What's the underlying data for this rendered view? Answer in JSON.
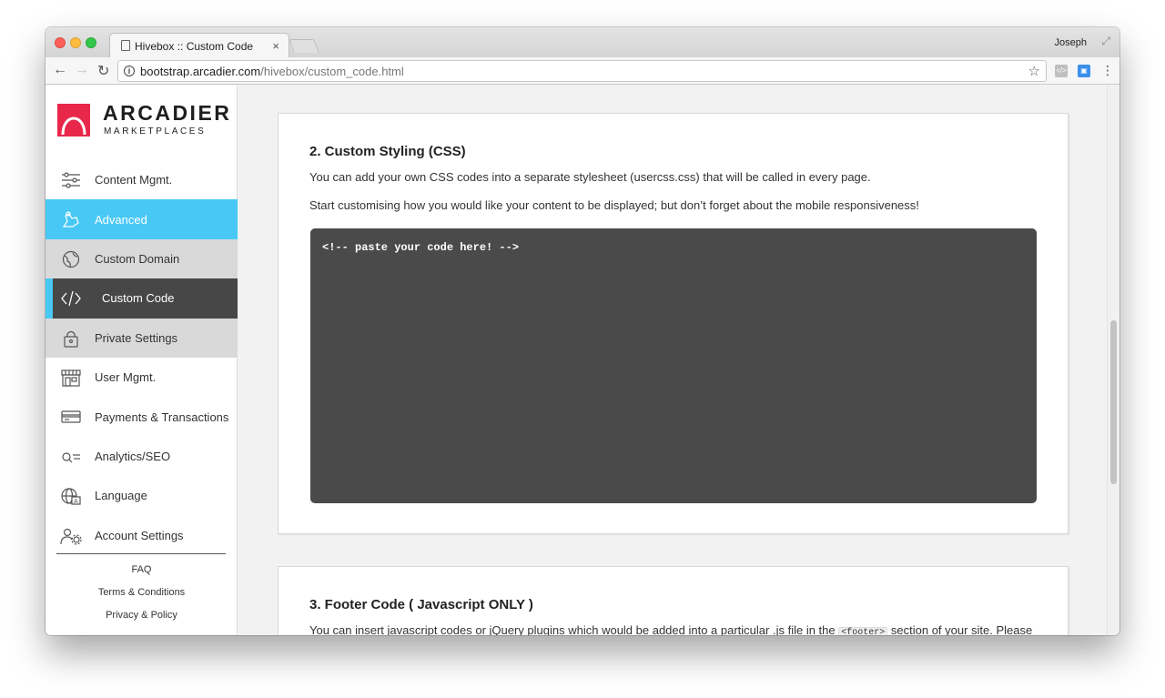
{
  "browser": {
    "tab_title": "Hivebox :: Custom Code",
    "tab_close": "×",
    "profile_name": "Joseph",
    "url_host": "bootstrap.arcadier.com",
    "url_path": "/hivebox/custom_code.html"
  },
  "brand": {
    "name": "ARCADIER",
    "tagline": "MARKETPLACES",
    "color": "#e8274b"
  },
  "sidebar": {
    "items": [
      {
        "label": "Content Mgmt.",
        "icon": "sliders-icon"
      },
      {
        "label": "Advanced",
        "icon": "hand-settings-icon"
      },
      {
        "label": "Custom Domain",
        "icon": "globe-icon"
      },
      {
        "label": "Custom Code",
        "icon": "code-icon"
      },
      {
        "label": "Private Settings",
        "icon": "lock-icon"
      },
      {
        "label": "User Mgmt.",
        "icon": "storefront-icon"
      },
      {
        "label": "Payments & Transactions",
        "icon": "card-icon"
      },
      {
        "label": "Analytics/SEO",
        "icon": "search-list-icon"
      },
      {
        "label": "Language",
        "icon": "language-globe-icon"
      },
      {
        "label": "Account Settings",
        "icon": "users-gear-icon"
      }
    ],
    "footer": [
      "FAQ",
      "Terms & Conditions",
      "Privacy & Policy"
    ]
  },
  "section_css": {
    "title": "2. Custom Styling (CSS)",
    "desc1": "You can add your own CSS codes into a separate stylesheet (usercss.css) that will be called in every page.",
    "desc2": "Start customising how you would like your content to be displayed; but don’t forget about the mobile responsiveness!",
    "code_placeholder": "<!-- paste your code here! -->"
  },
  "section_footer": {
    "title": "3. Footer Code ( Javascript ONLY )",
    "desc_a": "You can insert javascript codes or jQuery plugins which would be added into a particular .js file in the",
    "desc_code": "<footer>",
    "desc_b": "section of your site. Please"
  },
  "colors": {
    "accent": "#48c8f5",
    "active_bg": "#474747",
    "code_bg": "#4a4a4a"
  }
}
